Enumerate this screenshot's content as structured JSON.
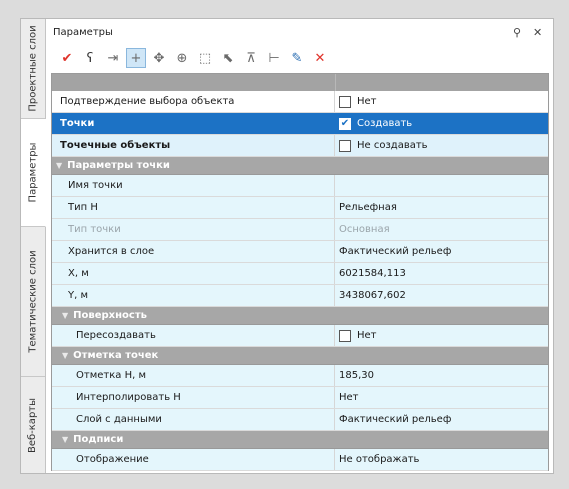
{
  "side_tabs": [
    {
      "label": "Проектные слои"
    },
    {
      "label": "Параметры"
    },
    {
      "label": "Тематические слои"
    },
    {
      "label": "Веб-карты"
    }
  ],
  "panel": {
    "title": "Параметры",
    "pin_icon": "pin-icon",
    "close_icon": "close-icon"
  },
  "toolbar": [
    {
      "name": "accept-icon",
      "glyph": "✔",
      "style": "red"
    },
    {
      "name": "lasso-select-icon",
      "glyph": "ʕ",
      "style": "dark"
    },
    {
      "name": "select-to-end-icon",
      "glyph": "⇥",
      "style": "plain"
    },
    {
      "name": "add-point-icon",
      "glyph": "+",
      "style": "sel"
    },
    {
      "name": "move-point-icon",
      "glyph": "✥",
      "style": "plain"
    },
    {
      "name": "snap-point-icon",
      "glyph": "⊕",
      "style": "plain"
    },
    {
      "name": "select-objects-icon",
      "glyph": "⬚",
      "style": "plain"
    },
    {
      "name": "select-filter-icon",
      "glyph": "⬉",
      "style": "plain"
    },
    {
      "name": "align-icon",
      "glyph": "⊼",
      "style": "plain"
    },
    {
      "name": "measure-icon",
      "glyph": "⊢",
      "style": "plain"
    },
    {
      "name": "pick-style-icon",
      "glyph": "✎",
      "style": "blue"
    },
    {
      "name": "delete-icon",
      "glyph": "✕",
      "style": "red"
    }
  ],
  "rows": [
    {
      "type": "plain",
      "label": "Подтверждение выбора объекта",
      "value": "Нет",
      "checkbox": true,
      "checked": false
    },
    {
      "type": "selected",
      "label": "Точки",
      "value": "Создавать",
      "checkbox": true,
      "checked": true
    },
    {
      "type": "light",
      "label": "Точечные объекты",
      "value": "Не создавать",
      "checkbox": true,
      "checked": false
    },
    {
      "type": "cat",
      "label": "Параметры точки"
    },
    {
      "type": "prop",
      "label": "Имя точки",
      "value": ""
    },
    {
      "type": "prop",
      "label": "Тип Н",
      "value": "Рельефная"
    },
    {
      "type": "prop disabled",
      "label": "Тип точки",
      "value": "Основная"
    },
    {
      "type": "prop",
      "label": "Хранится в слое",
      "value": "Фактический рельеф"
    },
    {
      "type": "prop",
      "label": "X, м",
      "value": "6021584,113"
    },
    {
      "type": "prop",
      "label": "Y, м",
      "value": "3438067,602"
    },
    {
      "type": "cat sub",
      "label": "Поверхность"
    },
    {
      "type": "prop sub",
      "label": "Пересоздавать",
      "value": "Нет",
      "checkbox": true,
      "checked": false
    },
    {
      "type": "cat sub",
      "label": "Отметка точек"
    },
    {
      "type": "prop sub",
      "label": "Отметка Н, м",
      "value": "185,30"
    },
    {
      "type": "prop sub",
      "label": "Интерполировать Н",
      "value": "Нет"
    },
    {
      "type": "prop sub",
      "label": "Слой с данными",
      "value": "Фактический рельеф"
    },
    {
      "type": "cat sub",
      "label": "Подписи"
    },
    {
      "type": "prop sub",
      "label": "Отображение",
      "value": "Не отображать"
    }
  ]
}
